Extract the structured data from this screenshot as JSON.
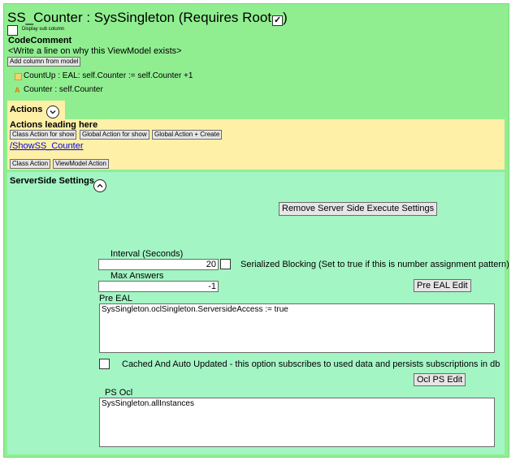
{
  "header": {
    "title": "SS_Counter : SysSingleton  (Requires Root",
    "requires_root_checked": true,
    "display_sub_column": "Display sub column",
    "code_comment_heading": "CodeComment",
    "code_comment_text": "<Write a line on why this ViewModel exists>",
    "add_column_label": "Add column from model"
  },
  "columns": [
    {
      "icon": "action-column-icon",
      "text": "CountUp : EAL: self.Counter := self.Counter +1"
    },
    {
      "icon": "attribute-column-icon",
      "text": "Counter : self.Counter"
    }
  ],
  "actions": {
    "heading": "Actions",
    "leading_heading": "Actions leading here",
    "buttons": [
      "Class Action for show",
      "Global Action for show",
      "Global Action + Create"
    ],
    "link": "/ShowSS_Counter",
    "bottom_buttons": [
      "Class Action",
      "ViewModel Action"
    ]
  },
  "serverside": {
    "heading": "ServerSide Settings",
    "remove_button": "Remove Server Side Execute Settings",
    "interval_label": "Interval (Seconds)",
    "interval_value": "20",
    "serialized_label": "Serialized Blocking (Set to true if this is number assignment pattern)",
    "serialized_checked": false,
    "max_answers_label": "Max Answers",
    "max_answers_value": "-1",
    "pre_eal_edit": "Pre EAL Edit",
    "pre_eal_label": "Pre EAL",
    "pre_eal_value": "SysSingleton.oclSingleton.ServersideAccess := true",
    "cached_label": "Cached And Auto Updated - this option subscribes to used data and persists subscriptions in db",
    "cached_checked": false,
    "ocl_ps_edit": "Ocl PS Edit",
    "ps_ocl_label": "PS Ocl",
    "ps_ocl_value": "SysSingleton.allInstances"
  },
  "colors": {
    "outer_bg": "#90ee90",
    "actions_bg": "#fff0a8",
    "serverside_bg": "#a3f5c4",
    "link": "#0000ee"
  }
}
